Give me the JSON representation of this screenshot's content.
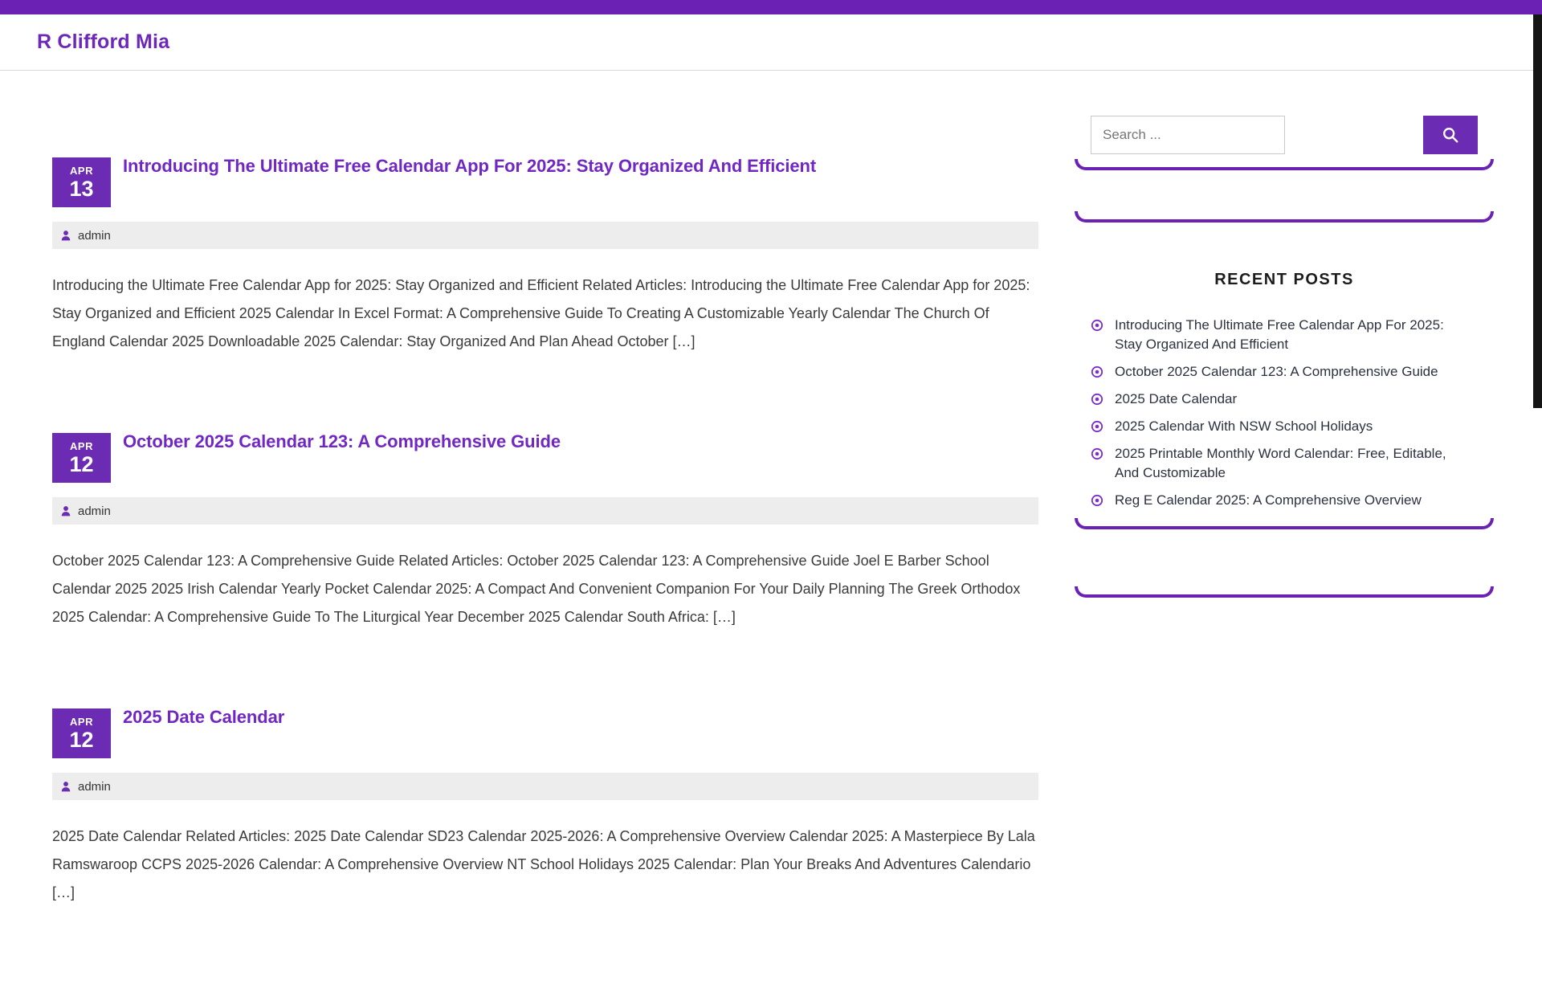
{
  "site": {
    "title": "R Clifford Mia"
  },
  "colors": {
    "brand_purple": "#6b21b4",
    "badge_purple": "#6b2bb3",
    "title_purple": "#7127c2",
    "meta_bg": "#ededed",
    "body_text": "#3a3a3a",
    "sidebar_link": "#2c3140"
  },
  "search": {
    "placeholder": "Search ...",
    "icon": "search-icon"
  },
  "sidebar": {
    "recent_posts_title": "RECENT POSTS",
    "recent_posts": [
      "Introducing The Ultimate Free Calendar App For 2025: Stay Organized And Efficient",
      "October 2025 Calendar 123: A Comprehensive Guide",
      "2025 Date Calendar",
      "2025 Calendar With NSW School Holidays",
      "2025 Printable Monthly Word Calendar: Free, Editable, And Customizable",
      "Reg E Calendar 2025: A Comprehensive Overview"
    ]
  },
  "posts": [
    {
      "month": "APR",
      "day": "13",
      "title": "Introducing The Ultimate Free Calendar App For 2025: Stay Organized And Efficient",
      "author": "admin",
      "excerpt": "Introducing the Ultimate Free Calendar App for 2025: Stay Organized and Efficient Related Articles: Introducing the Ultimate Free Calendar App for 2025: Stay Organized and Efficient 2025 Calendar In Excel Format: A Comprehensive Guide To Creating A Customizable Yearly Calendar The Church Of England Calendar 2025 Downloadable 2025 Calendar: Stay Organized And Plan Ahead October […]"
    },
    {
      "month": "APR",
      "day": "12",
      "title": "October 2025 Calendar 123: A Comprehensive Guide",
      "author": "admin",
      "excerpt": "October 2025 Calendar 123: A Comprehensive Guide Related Articles: October 2025 Calendar 123: A Comprehensive Guide Joel E Barber School Calendar 2025 2025 Irish Calendar Yearly Pocket Calendar 2025: A Compact And Convenient Companion For Your Daily Planning The Greek Orthodox 2025 Calendar: A Comprehensive Guide To The Liturgical Year December 2025 Calendar South Africa: […]"
    },
    {
      "month": "APR",
      "day": "12",
      "title": "2025 Date Calendar",
      "author": "admin",
      "excerpt": "2025 Date Calendar Related Articles: 2025 Date Calendar SD23 Calendar 2025-2026: A Comprehensive Overview Calendar 2025: A Masterpiece By Lala Ramswaroop CCPS 2025-2026 Calendar: A Comprehensive Overview NT School Holidays 2025 Calendar: Plan Your Breaks And Adventures Calendario […]"
    }
  ]
}
